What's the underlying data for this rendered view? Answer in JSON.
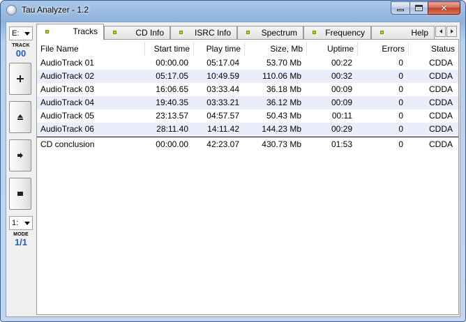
{
  "window": {
    "title": "Tau Analyzer - 1.2"
  },
  "toolbar": {
    "drive": "E:",
    "track_label": "TRACK",
    "track_value": "00",
    "mode_select": "1:",
    "mode_label": "MODE",
    "mode_value": "1/1"
  },
  "tabs": [
    {
      "label": "Tracks",
      "active": true
    },
    {
      "label": "CD Info"
    },
    {
      "label": "ISRC Info"
    },
    {
      "label": "Spectrum"
    },
    {
      "label": "Frequency"
    },
    {
      "label": "Help"
    }
  ],
  "table": {
    "columns": [
      "File Name",
      "Start time",
      "Play time",
      "Size, Mb",
      "Uptime",
      "Errors",
      "Status"
    ],
    "rows": [
      [
        "AudioTrack 01",
        "00:00.00",
        "05:17.04",
        "53.70 Mb",
        "00:22",
        "0",
        "CDDA"
      ],
      [
        "AudioTrack 02",
        "05:17.05",
        "10:49.59",
        "110.06 Mb",
        "00:32",
        "0",
        "CDDA"
      ],
      [
        "AudioTrack 03",
        "16:06.65",
        "03:33.44",
        "36.18 Mb",
        "00:09",
        "0",
        "CDDA"
      ],
      [
        "AudioTrack 04",
        "19:40.35",
        "03:33.21",
        "36.12 Mb",
        "00:09",
        "0",
        "CDDA"
      ],
      [
        "AudioTrack 05",
        "23:13.57",
        "04:57.57",
        "50.43 Mb",
        "00:11",
        "0",
        "CDDA"
      ],
      [
        "AudioTrack 06",
        "28:11.40",
        "14:11.42",
        "144.23 Mb",
        "00:29",
        "0",
        "CDDA"
      ]
    ],
    "summary": [
      "CD conclusion",
      "00:00.00",
      "42:23.07",
      "430.73 Mb",
      "01:53",
      "0",
      "CDDA"
    ]
  }
}
